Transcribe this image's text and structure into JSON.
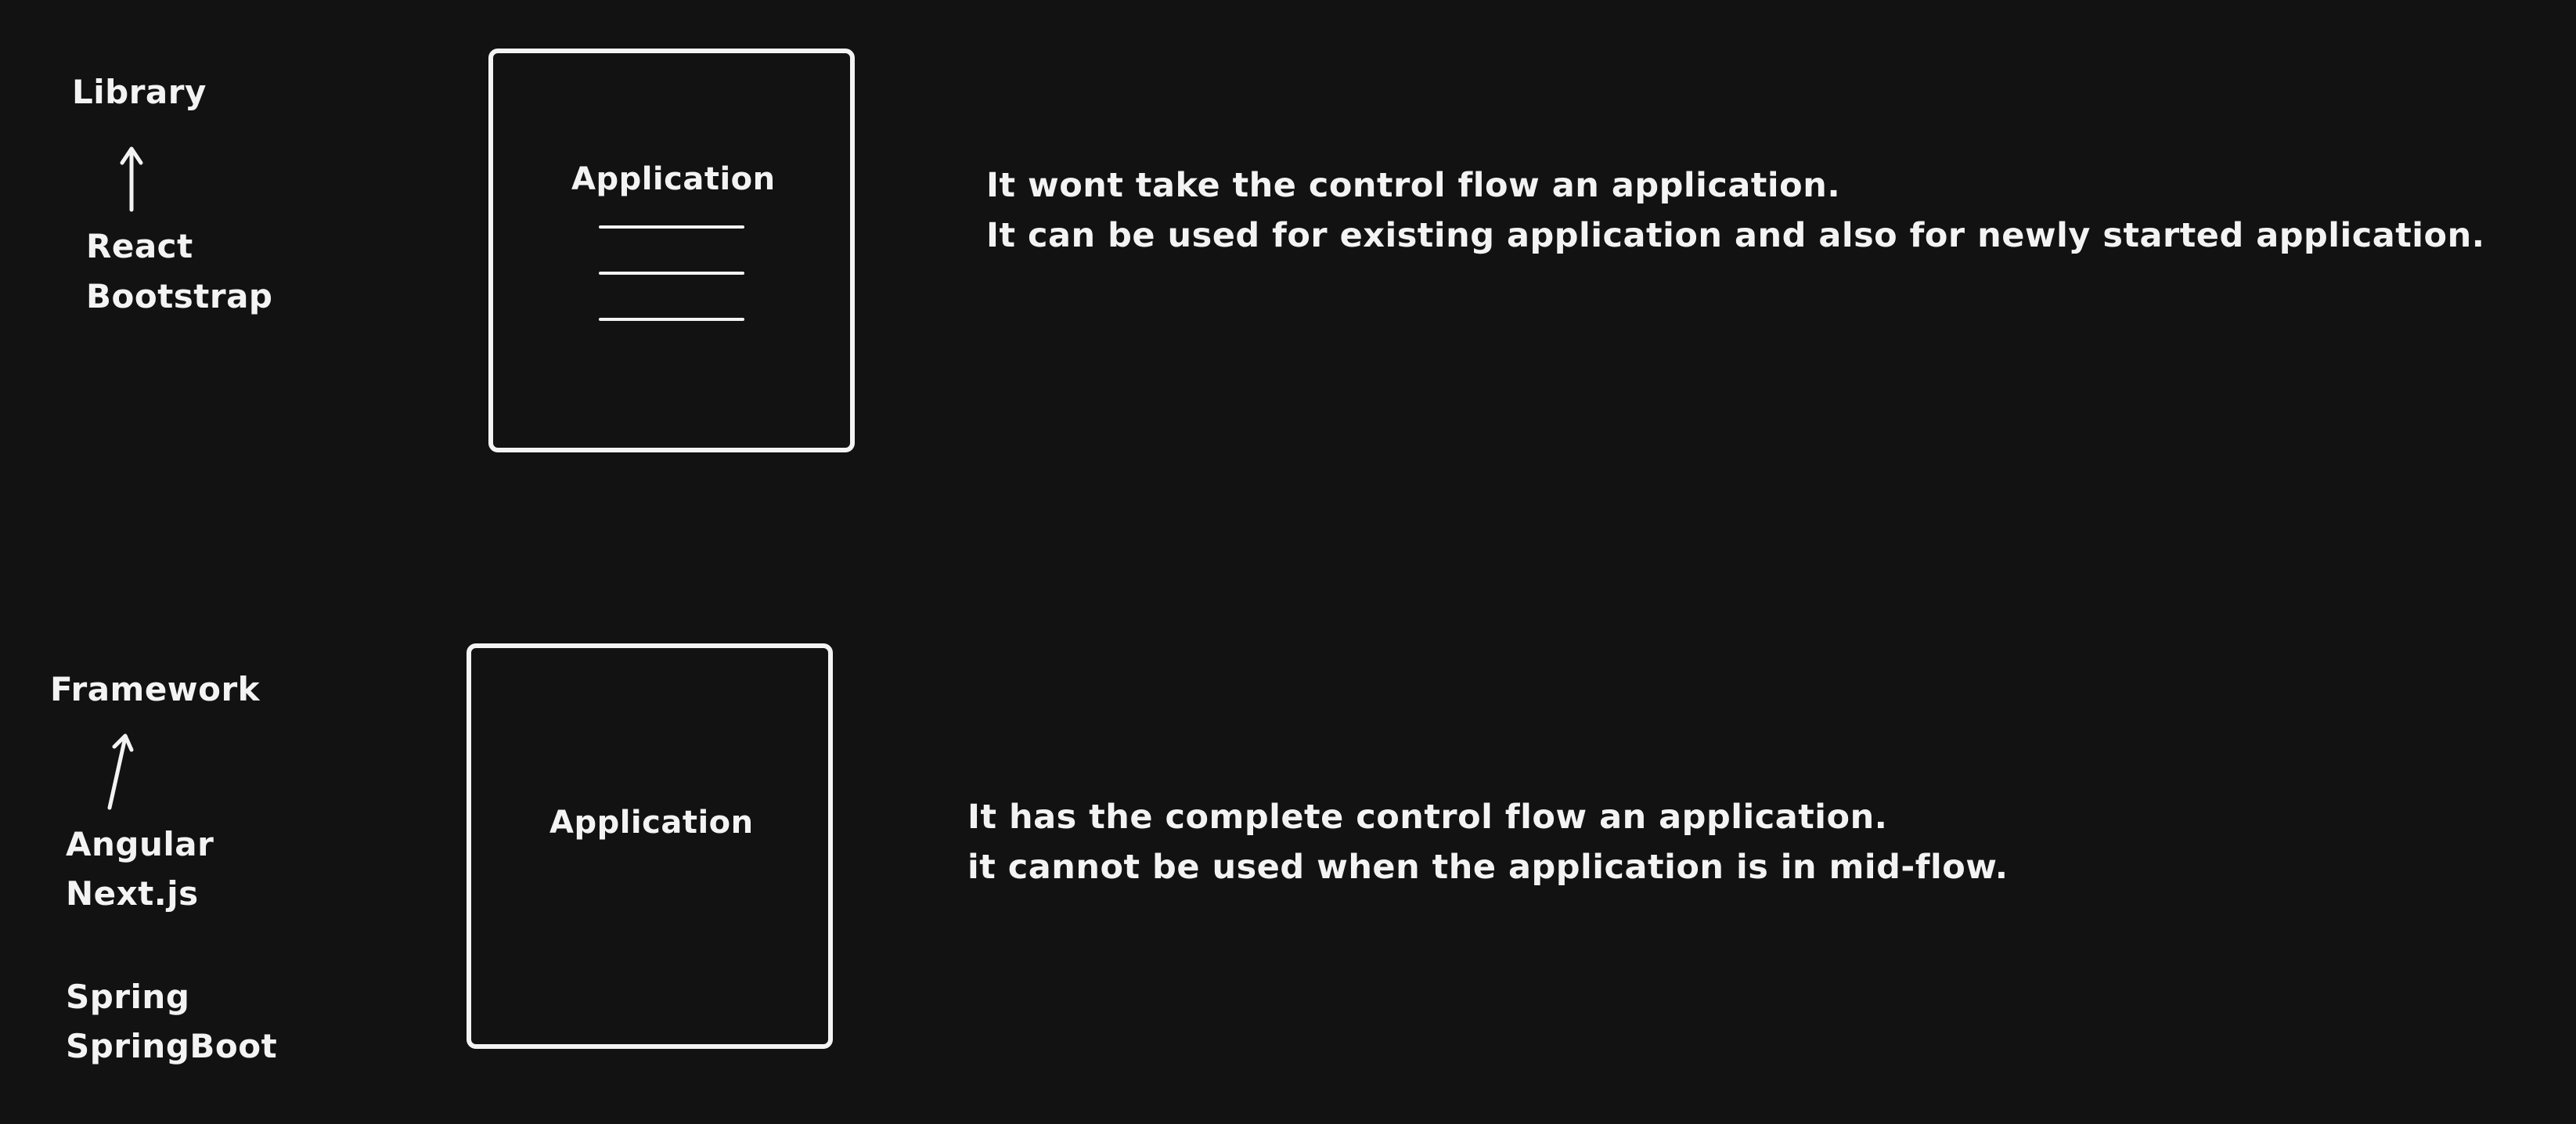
{
  "colors": {
    "background": "#121212",
    "stroke": "#f3f3f3"
  },
  "library": {
    "heading": "Library",
    "examples": [
      "React",
      "Bootstrap"
    ],
    "box_label": "Application",
    "notes": [
      "It wont take the control flow an application.",
      "It can be used for existing application and also for newly started application."
    ]
  },
  "framework": {
    "heading": "Framework",
    "examples": [
      "Angular",
      "Next.js",
      "Spring",
      "SpringBoot"
    ],
    "box_label": "Application",
    "notes": [
      "It has the complete control flow an application.",
      "it cannot be used when the application is in mid-flow."
    ]
  }
}
